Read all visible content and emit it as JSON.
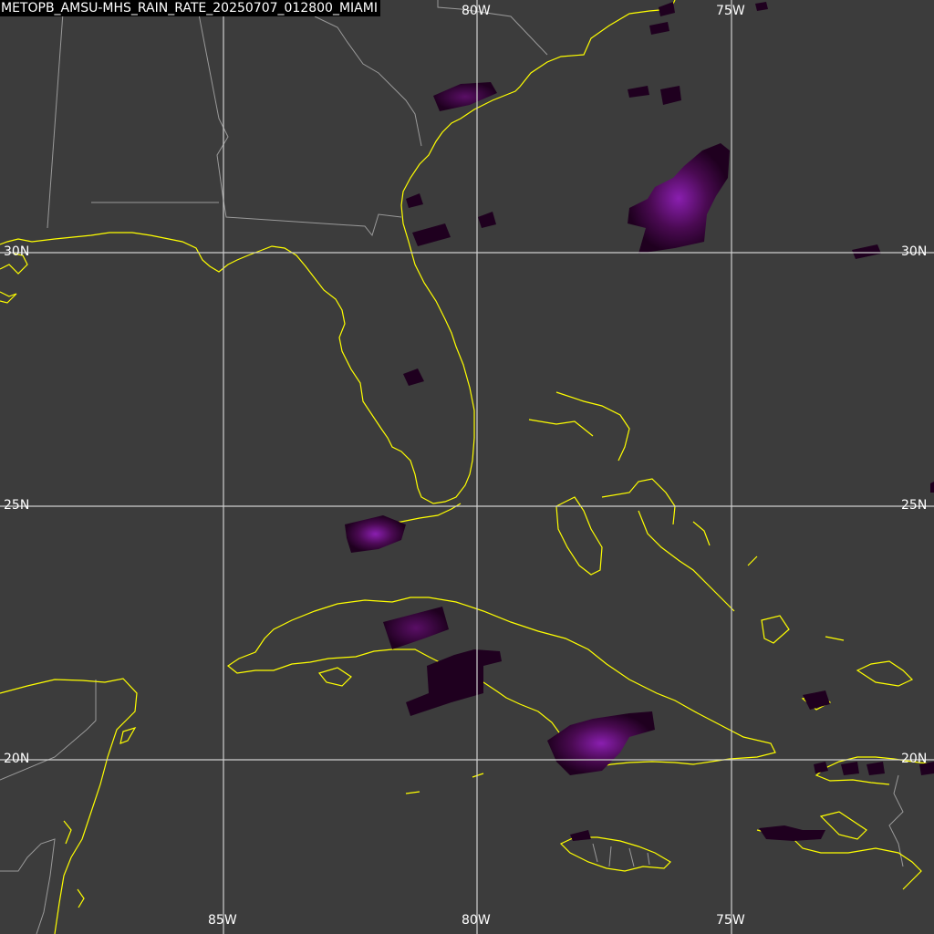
{
  "title": "METOPB_AMSU-MHS_RAIN_RATE_20250707_012800_MIAMI",
  "product": {
    "satellite": "METOPB",
    "instrument": "AMSU-MHS",
    "parameter": "RAIN_RATE",
    "date": "20250707",
    "time": "012800",
    "sector": "MIAMI"
  },
  "grid": {
    "lon_top": [
      "80W",
      "75W"
    ],
    "lon_bottom": [
      "85W",
      "80W",
      "75W"
    ],
    "lat_left": [
      "30N",
      "25N",
      "20N"
    ],
    "lat_right": [
      "30N",
      "25N",
      "20N"
    ]
  },
  "colors": {
    "background": "#3c3c3c",
    "gridline": "#d0d0d0",
    "coastline": "#ffff00",
    "political_border": "#9a9a9a",
    "rain_low": "#1f001f",
    "rain_mid": "#4a0a52",
    "rain_high": "#8a1fb0",
    "title_bg": "#000000",
    "label_text": "#ffffff"
  },
  "legend": "none"
}
